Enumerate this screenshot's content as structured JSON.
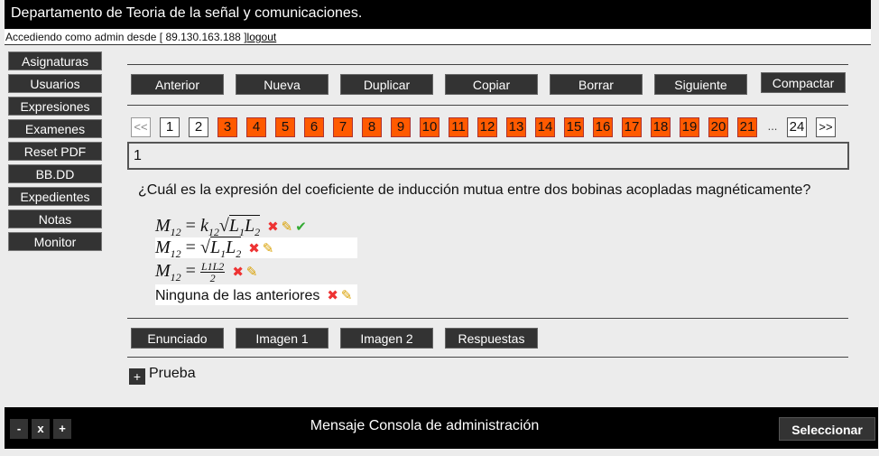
{
  "header": {
    "title": "Departamento de Teoria de la señal y comunicaciones."
  },
  "login": {
    "text": "Accediendo como admin desde [ 89.130.163.188 ]",
    "logout": "logout"
  },
  "sidebar": {
    "items": [
      "Asignaturas",
      "Usuarios",
      "Expresiones",
      "Examenes",
      "Reset PDF",
      "BB.DD",
      "Expedientes",
      "Notas",
      "Monitor"
    ]
  },
  "toolbar": {
    "anterior": "Anterior",
    "nueva": "Nueva",
    "duplicar": "Duplicar",
    "copiar": "Copiar",
    "borrar": "Borrar",
    "siguiente": "Siguiente",
    "compactar": "Compactar"
  },
  "pagination": {
    "prev": "<<",
    "pages": [
      "1",
      "2",
      "3",
      "4",
      "5",
      "6",
      "7",
      "8",
      "9",
      "10",
      "11",
      "12",
      "13",
      "14",
      "15",
      "16",
      "17",
      "18",
      "19",
      "20",
      "21"
    ],
    "ellipsis": "...",
    "last": "24",
    "next": ">>"
  },
  "current_page_value": "1",
  "question": "¿Cuál es la expresión del coeficiente de inducción mutua entre dos bobinas acopladas magnéticamente?",
  "answers": {
    "a1": {
      "lhs": "M",
      "lhs_sub": "12",
      "k": "k",
      "k_sub": "12",
      "l1": "L",
      "l1_sub": "1",
      "l2": "L",
      "l2_sub": "2"
    },
    "a2": {
      "lhs": "M",
      "lhs_sub": "12",
      "l1": "L",
      "l1_sub": "1",
      "l2": "L",
      "l2_sub": "2"
    },
    "a3": {
      "lhs": "M",
      "lhs_sub": "12",
      "num": "L1L2",
      "den": "2"
    },
    "a4": {
      "text": "Ninguna de las anteriores"
    }
  },
  "icons": {
    "delete": "✖",
    "edit": "✎",
    "correct": "✔"
  },
  "tabs": {
    "enunciado": "Enunciado",
    "imagen1": "Imagen 1",
    "imagen2": "Imagen 2",
    "respuestas": "Respuestas"
  },
  "prueba": {
    "plus": "+",
    "label": "Prueba"
  },
  "footer": {
    "minus": "-",
    "close": "x",
    "plus": "+",
    "message": "Mensaje Consola de administración",
    "select": "Seleccionar"
  },
  "colors": {
    "page_active": "#ff5a00",
    "bar": "#000000",
    "button": "#333333"
  }
}
